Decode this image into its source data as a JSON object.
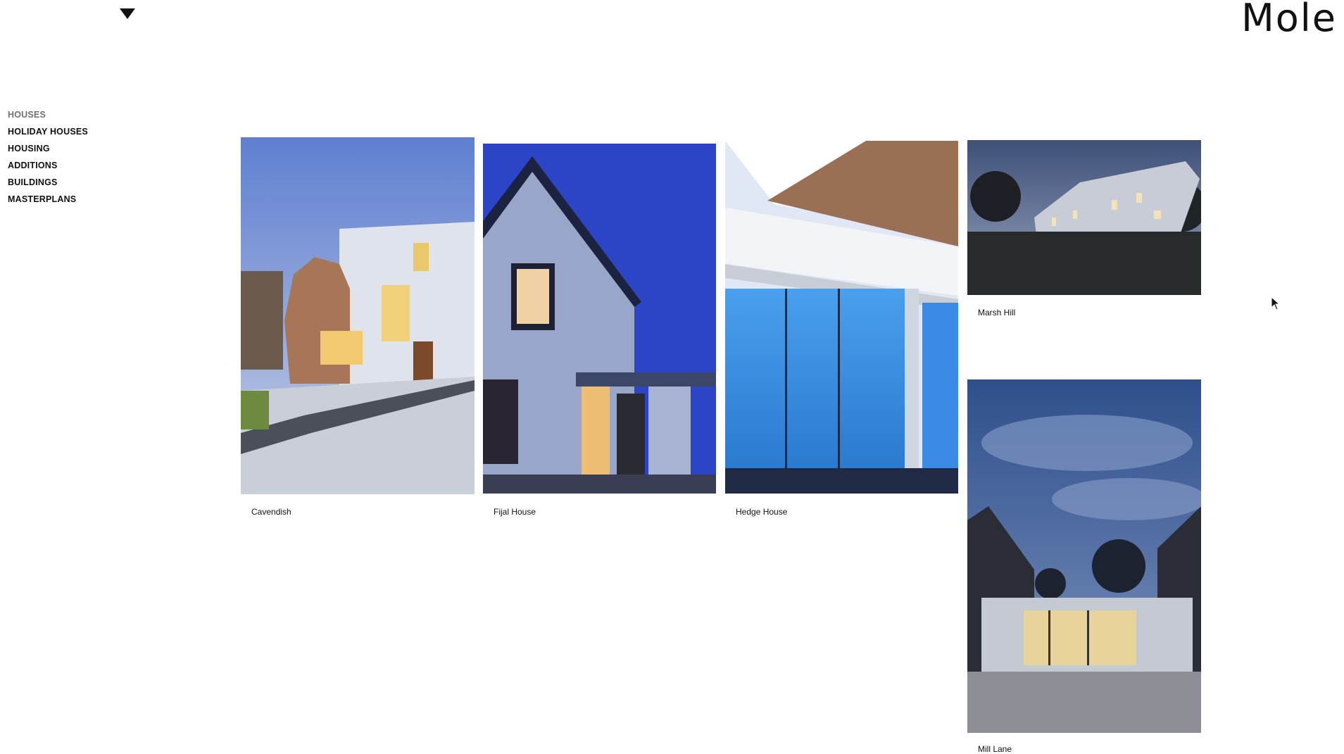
{
  "header": {
    "logo": "Mole",
    "menu_icon": "triangle-down-icon"
  },
  "nav": {
    "items": [
      {
        "label": "HOUSES",
        "active": true
      },
      {
        "label": "HOLIDAY HOUSES"
      },
      {
        "label": "HOUSING"
      },
      {
        "label": "ADDITIONS"
      },
      {
        "label": "BUILDINGS"
      },
      {
        "label": "MASTERPLANS"
      }
    ]
  },
  "projects": [
    {
      "title": "Cavendish"
    },
    {
      "title": "Fijal House"
    },
    {
      "title": "Hedge House"
    },
    {
      "title": "Marsh Hill"
    },
    {
      "title": "Mill Lane"
    }
  ],
  "colors": {
    "text": "#111111",
    "nav_active": "#707070",
    "background": "#ffffff"
  }
}
